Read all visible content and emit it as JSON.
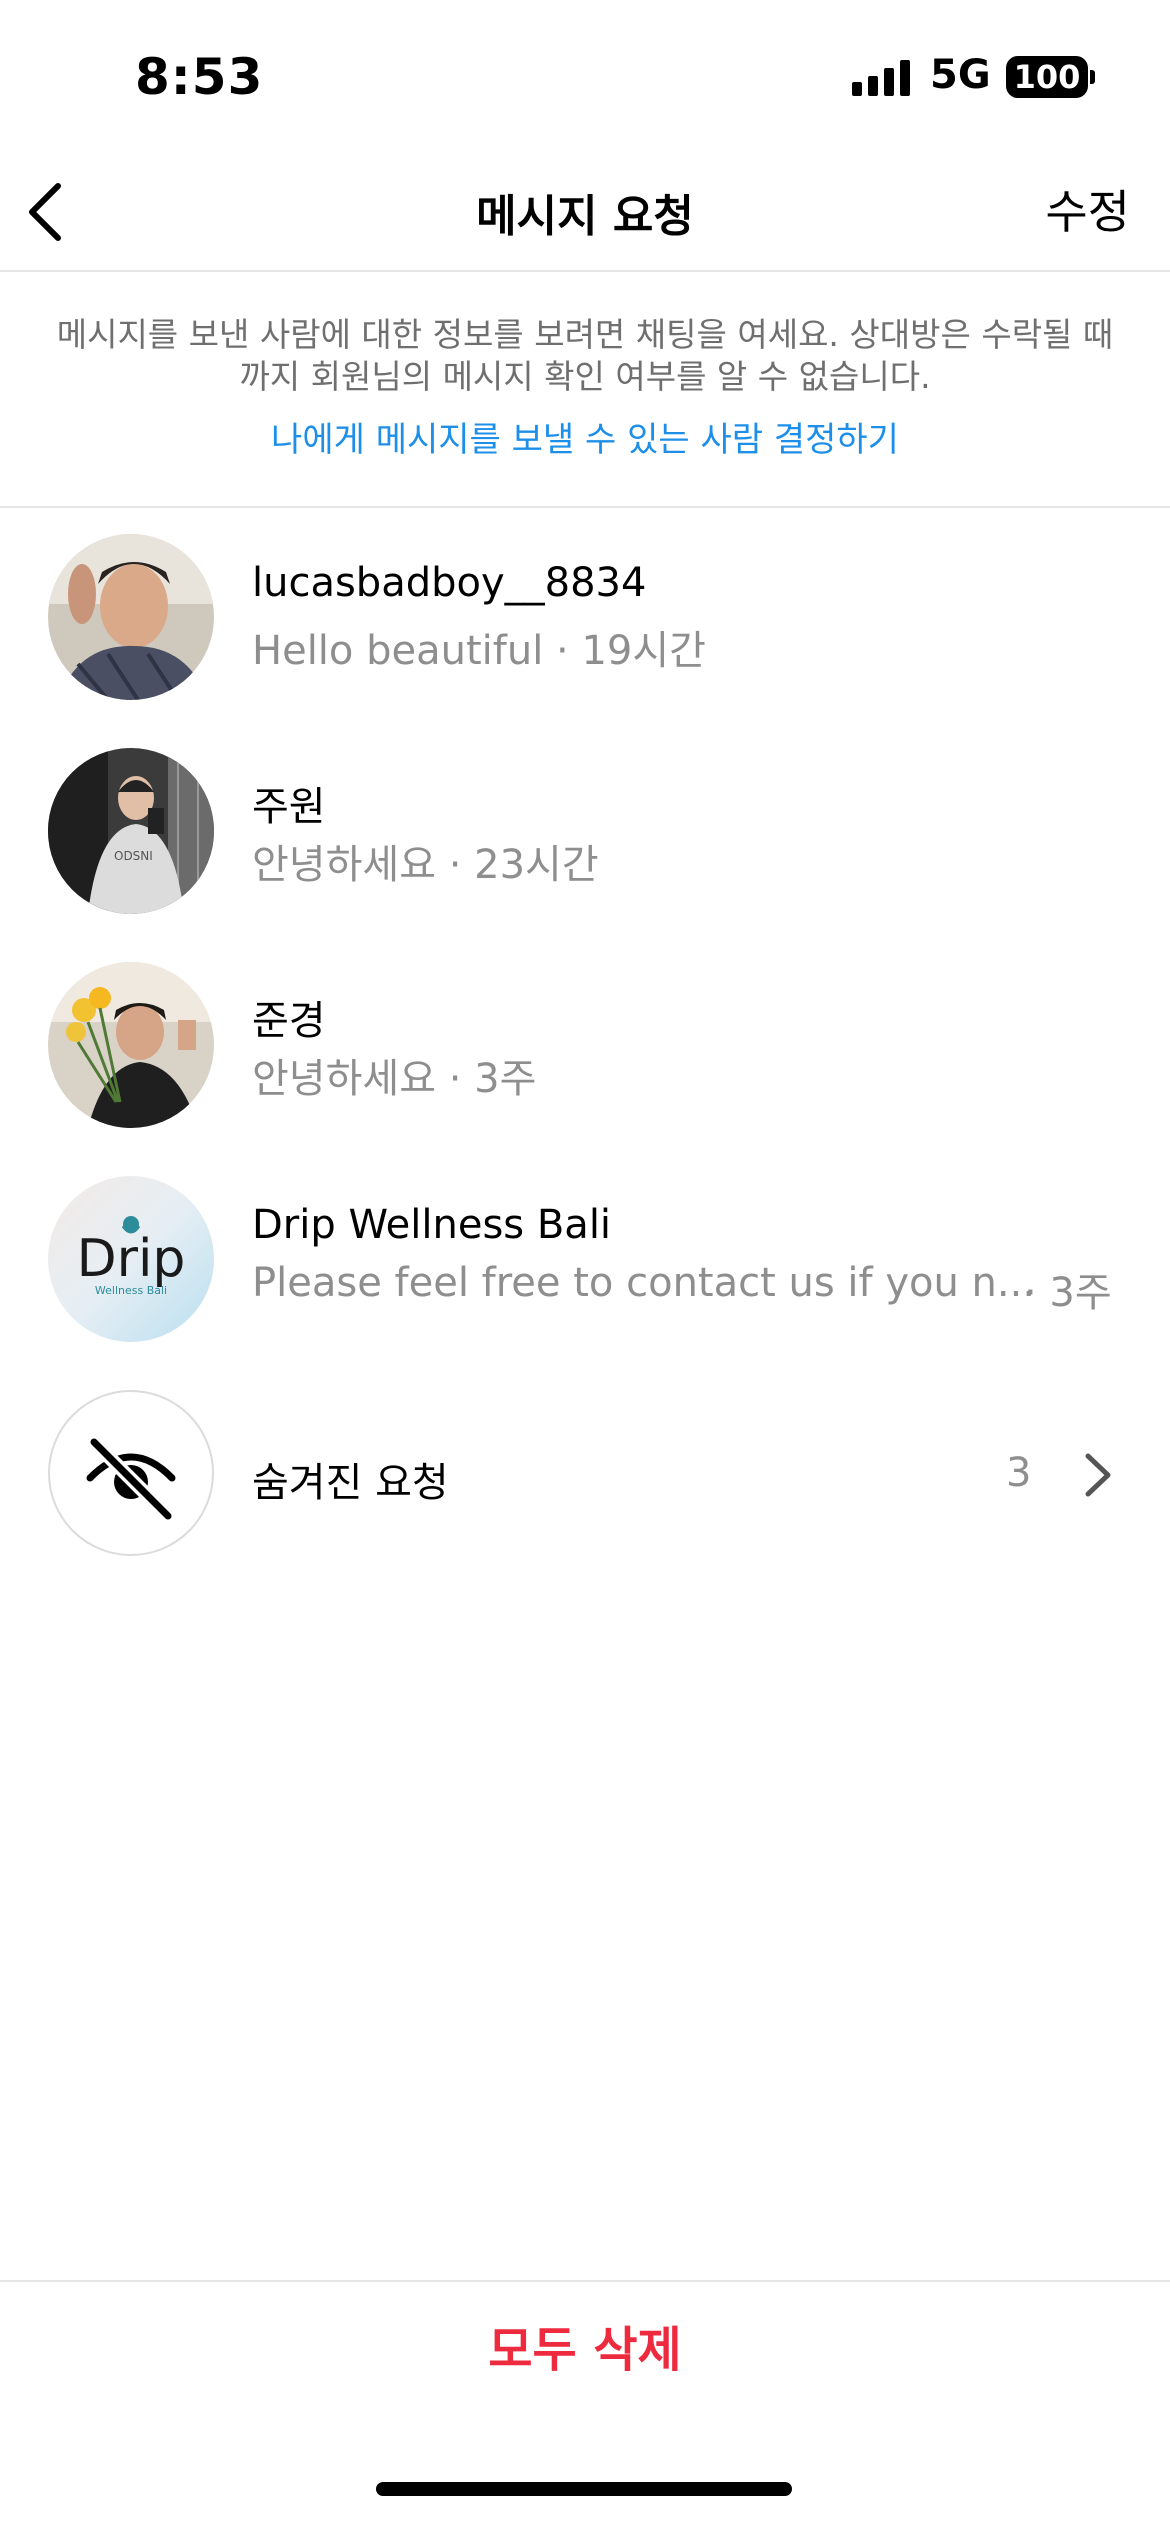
{
  "status": {
    "time": "8:53",
    "network": "5G",
    "battery": "100"
  },
  "nav": {
    "title": "메시지 요청",
    "edit_label": "수정"
  },
  "info": {
    "text": "메시지를 보낸 사람에 대한 정보를 보려면 채팅을 여세요. 상대방은 수락될 때까지 회원님의 메시지 확인 여부를 알 수 없습니다.",
    "link": "나에게 메시지를 보낼 수 있는 사람 결정하기"
  },
  "requests": [
    {
      "name": "lucasbadboy__8834",
      "preview": "Hello beautiful · 19시간"
    },
    {
      "name": "주원",
      "preview": "안녕하세요 · 23시간"
    },
    {
      "name": "준경",
      "preview": "안녕하세요 · 3주"
    },
    {
      "name": "Drip Wellness Bali",
      "preview": "Please feel free to contact us if you n...",
      "time": "· 3주",
      "avatar_logo": "Drip",
      "avatar_logo_sub": "Wellness Bali"
    }
  ],
  "hidden": {
    "label": "숨겨진 요청",
    "count": "3"
  },
  "bottom": {
    "delete_all": "모두 삭제"
  },
  "colors": {
    "link": "#1e8fe8",
    "destructive": "#ee2a3e",
    "secondary_text": "#8e8e8e"
  },
  "icons": [
    "back-arrow-icon",
    "signal-icon",
    "battery-icon",
    "hidden-eye-icon",
    "chevron-right-icon"
  ]
}
